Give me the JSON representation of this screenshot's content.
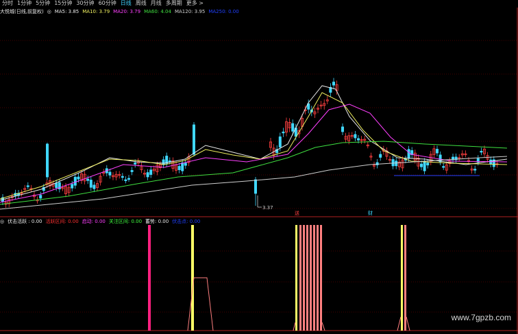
{
  "tabs": [
    "分时",
    "1分钟",
    "5分钟",
    "15分钟",
    "30分钟",
    "60分钟",
    "日线",
    "周线",
    "月线",
    "多周期",
    "更多 >"
  ],
  "active_tab": "日线",
  "price_panel": {
    "title": "大悦城(日线,前复权)",
    "ma_items": [
      {
        "label": "MA5: 3.85",
        "color": "#e8e8e8"
      },
      {
        "label": "MA10: 3.79",
        "color": "#f0f060"
      },
      {
        "label": "MA20: 3.79",
        "color": "#ff40ff"
      },
      {
        "label": "MA60: 4.04",
        "color": "#40e040"
      },
      {
        "label": "MA120: 3.95",
        "color": "#d0d0d0"
      },
      {
        "label": "MA250: 0.00",
        "color": "#2040ff"
      }
    ],
    "low_price_label": "3.37",
    "marker_labels": [
      "送",
      "财"
    ]
  },
  "indicator_panel": {
    "items": [
      {
        "label": "伏击活跃 : 0.00",
        "color": "#e8e8e8"
      },
      {
        "label": "活跃区间: 0.00",
        "color": "#ff3030"
      },
      {
        "label": "启动: 0.00",
        "color": "#ff40ff"
      },
      {
        "label": "关注区间: 0.00",
        "color": "#40ff40"
      },
      {
        "label": "蓄势: 0.00",
        "color": "#e8e8e8"
      },
      {
        "label": "伏击点: 0.00",
        "color": "#2040ff"
      }
    ]
  },
  "colors": {
    "up": "#ff4040",
    "down": "#40d8ff",
    "grid": "#8b0000",
    "ma5": "#e8e8e8",
    "ma10": "#f0f060",
    "ma20": "#ff40ff",
    "ma60": "#40e040",
    "ma120": "#d0d0d0",
    "ma250": "#2040ff",
    "bar_magenta": "#ff2080",
    "bar_yellow": "#ffff66",
    "bar_salmon": "#ff8080"
  },
  "watermark": "www.7gpzb.com"
}
